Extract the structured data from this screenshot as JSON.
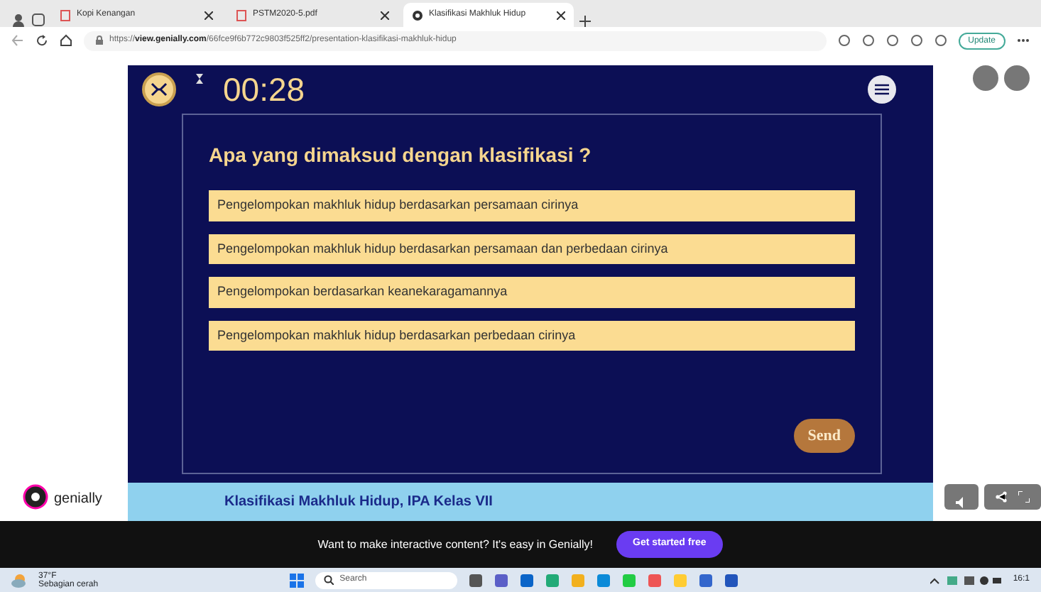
{
  "browser": {
    "tabs": [
      {
        "title": "Kopi Kenangan",
        "selected": false
      },
      {
        "title": "PSTM2020-5.pdf",
        "selected": false
      },
      {
        "title": "Klasifikasi Makhluk Hidup",
        "selected": true
      }
    ],
    "url_prefix": "https://",
    "url_host": "view.genially.com",
    "url_path": "/66fce9f6b772c9803f525ff2/presentation-klasifikasi-makhluk-hidup",
    "update_button": "Update"
  },
  "quiz": {
    "timer": "00:28",
    "question": "Apa yang dimaksud dengan klasifikasi ?",
    "options": [
      {
        "text": "Pengelompokan makhluk hidup berdasarkan persamaan cirinya"
      },
      {
        "text": "Pengelompokan makhluk hidup berdasarkan persamaan dan perbedaan cirinya"
      },
      {
        "text": "Pengelompokan berdasarkan keanekaragamannya"
      },
      {
        "text": "Pengelompokan makhluk hidup berdasarkan perbedaan cirinya"
      }
    ],
    "send_button": "Send",
    "footer_title": "Klasifikasi Makhluk Hidup, IPA Kelas VII"
  },
  "brand": "genially",
  "banner": {
    "text": "Want to make interactive content? It's easy in Genially!",
    "button": "Get started free"
  },
  "taskbar": {
    "weather_temp": "37°F",
    "weather_desc": "Sebagian cerah",
    "search_placeholder": "Search",
    "time": "16:1"
  }
}
